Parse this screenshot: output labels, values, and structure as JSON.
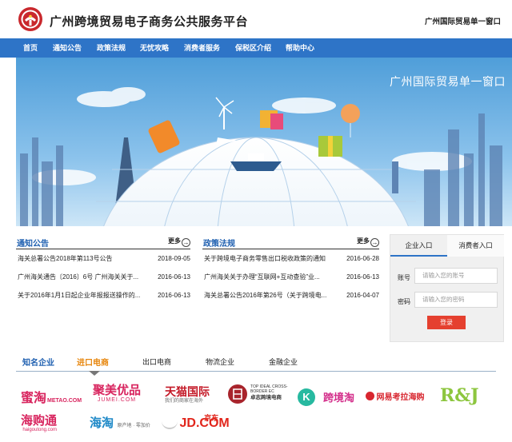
{
  "header": {
    "title": "广州跨境贸易电子商务公共服务平台",
    "right_link": "广州国际贸易单一窗口"
  },
  "nav": {
    "items": [
      "首页",
      "通知公告",
      "政策法规",
      "无忧攻略",
      "消费者服务",
      "保税区介绍",
      "帮助中心"
    ]
  },
  "banner": {
    "caption": "广州国际贸易单一窗口"
  },
  "notices": {
    "title": "通知公告",
    "more_label": "更多",
    "items": [
      {
        "title": "海关总署公告2018年第113号公告",
        "date": "2018-09-05"
      },
      {
        "title": "广州海关通告〔2016〕6号 广州海关关于...",
        "date": "2016-06-13"
      },
      {
        "title": "关于2016年1月1日起企业年报报送操作的...",
        "date": "2016-06-13"
      }
    ]
  },
  "policies": {
    "title": "政策法规",
    "more_label": "更多",
    "items": [
      {
        "title": "关于跨境电子商务零售出口税收政策的通知",
        "date": "2016-06-28"
      },
      {
        "title": "广州海关关于办理“互联网+互动查验”业...",
        "date": "2016-06-13"
      },
      {
        "title": "海关总署公告2016年第26号（关于跨境电...",
        "date": "2016-04-07"
      }
    ]
  },
  "login": {
    "tabs": [
      "企业入口",
      "消费者入口"
    ],
    "account_label": "账号",
    "account_placeholder": "请输入您的账号",
    "password_label": "密码",
    "password_placeholder": "请输入您的密码",
    "button": "登录",
    "accent_color": "#2e74c7",
    "button_color": "#e5402f"
  },
  "categories": {
    "tabs": [
      "知名企业",
      "进口电商",
      "出口电商",
      "物流企业",
      "金融企业"
    ],
    "active_index": 1
  },
  "brands": [
    {
      "name": "蜜淘",
      "sub": "METAO.COM"
    },
    {
      "name": "聚美优品",
      "sub": "JUMEI.COM"
    },
    {
      "name": "天猫国际",
      "sub": "我们的商家在海外"
    },
    {
      "name": "卓志跨境电商",
      "sub": "TOP IDEAL CROSS-BORDER EC"
    },
    {
      "name": "K",
      "sub": ""
    },
    {
      "name": "跨境淘",
      "sub": ""
    },
    {
      "name": "网易考拉海购",
      "sub": ""
    },
    {
      "name": "R&J",
      "sub": ""
    },
    {
      "name": "海购通",
      "sub": "haigoutong.com"
    },
    {
      "name": "海淘",
      "sub": "原产地 · 零加价"
    },
    {
      "name": "JD.COM",
      "sub": "京东"
    }
  ]
}
